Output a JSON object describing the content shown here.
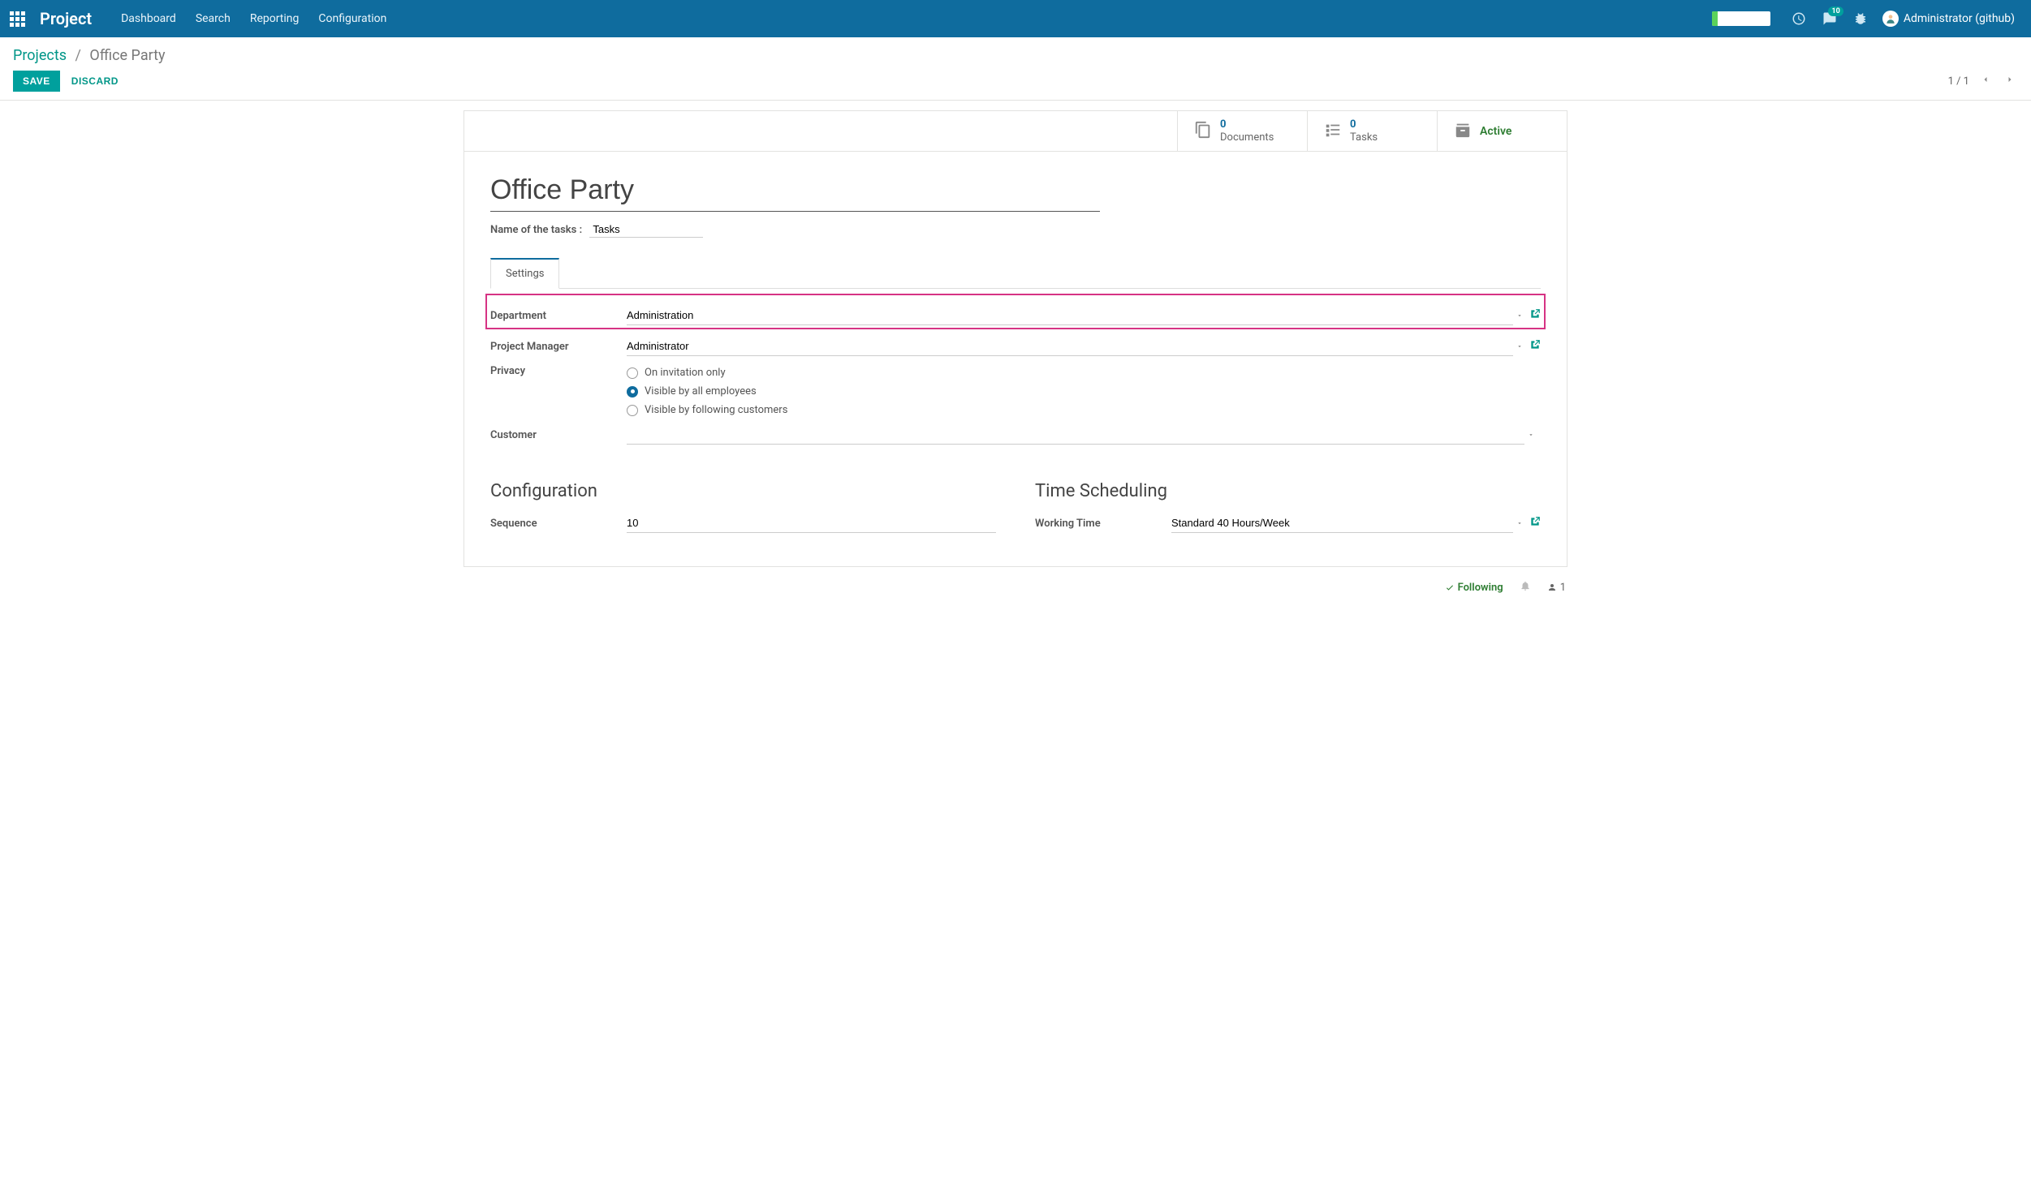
{
  "header": {
    "brand": "Project",
    "nav": [
      "Dashboard",
      "Search",
      "Reporting",
      "Configuration"
    ],
    "comment_badge": "10",
    "username": "Administrator (github)"
  },
  "breadcrumb": {
    "root": "Projects",
    "current": "Office Party"
  },
  "actions": {
    "save": "SAVE",
    "discard": "DISCARD"
  },
  "pager": {
    "text": "1 / 1"
  },
  "stats": {
    "documents_value": "0",
    "documents_label": "Documents",
    "tasks_value": "0",
    "tasks_label": "Tasks",
    "active_label": "Active"
  },
  "form": {
    "title": "Office Party",
    "tasks_name_label": "Name of the tasks :",
    "tasks_name_value": "Tasks",
    "tab_settings": "Settings",
    "department_label": "Department",
    "department_value": "Administration",
    "manager_label": "Project Manager",
    "manager_value": "Administrator",
    "privacy_label": "Privacy",
    "privacy_opts": {
      "invitation": "On invitation only",
      "employees": "Visible by all employees",
      "customers": "Visible by following customers"
    },
    "customer_label": "Customer",
    "customer_value": "",
    "config_heading": "Configuration",
    "sequence_label": "Sequence",
    "sequence_value": "10",
    "time_heading": "Time Scheduling",
    "working_time_label": "Working Time",
    "working_time_value": "Standard 40 Hours/Week"
  },
  "footer": {
    "following": "Following",
    "follower_count": "1"
  }
}
